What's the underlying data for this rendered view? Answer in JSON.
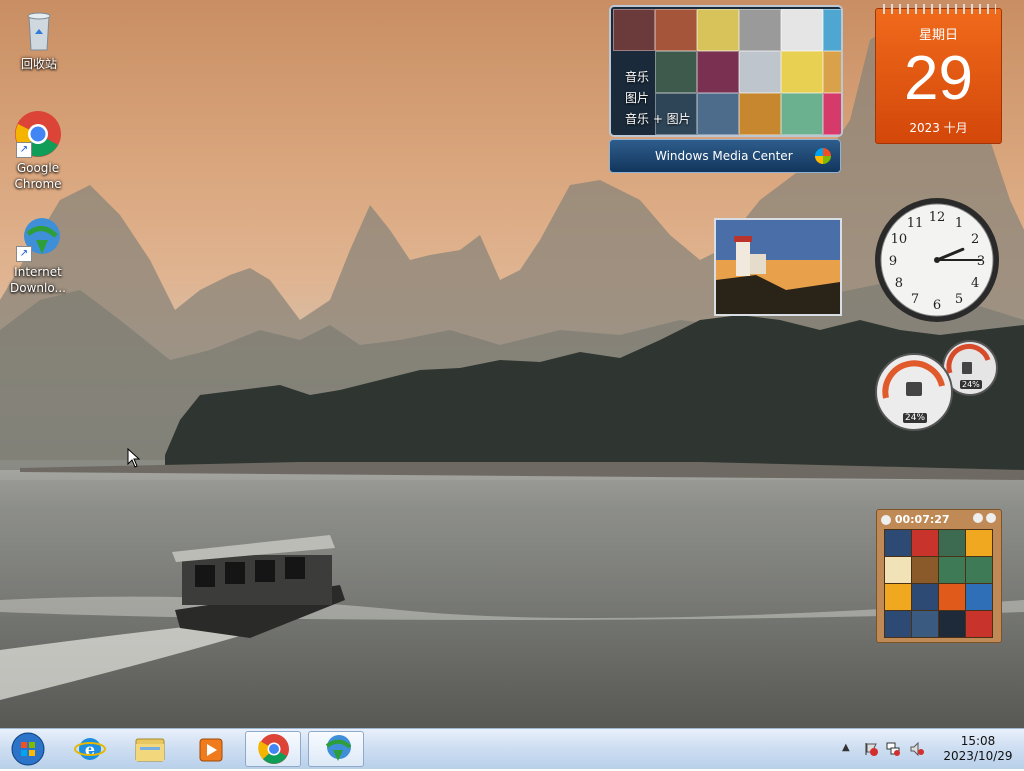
{
  "desktop_icons": [
    {
      "label": "回收站",
      "icon": "recycle-bin-icon"
    },
    {
      "label": "Google Chrome",
      "icon": "chrome-icon"
    },
    {
      "label": "Internet Downlo...",
      "icon": "internet-download-manager-icon"
    }
  ],
  "media_center": {
    "menu": [
      "音乐",
      "图片",
      "音乐 + 图片"
    ],
    "brand": "Windows Media Center"
  },
  "calendar": {
    "weekday": "星期日",
    "day": "29",
    "year_month": "2023 十月"
  },
  "clock": {
    "hour": 2,
    "minute": 15,
    "numbers": [
      "12",
      "1",
      "2",
      "3",
      "4",
      "5",
      "6",
      "7",
      "8",
      "9",
      "10",
      "11"
    ]
  },
  "cpu_meter": {
    "cpu": "24%",
    "memory": "24%"
  },
  "puzzle": {
    "timer": "00:07:27"
  },
  "taskbar": {
    "start": "start-orb-icon",
    "pinned": [
      {
        "name": "internet-explorer-icon"
      },
      {
        "name": "file-explorer-icon"
      },
      {
        "name": "media-player-icon"
      },
      {
        "name": "chrome-icon",
        "active": true
      },
      {
        "name": "internet-download-manager-icon",
        "active": true
      }
    ],
    "tray": {
      "time": "15:08",
      "date": "2023/10/29"
    }
  }
}
